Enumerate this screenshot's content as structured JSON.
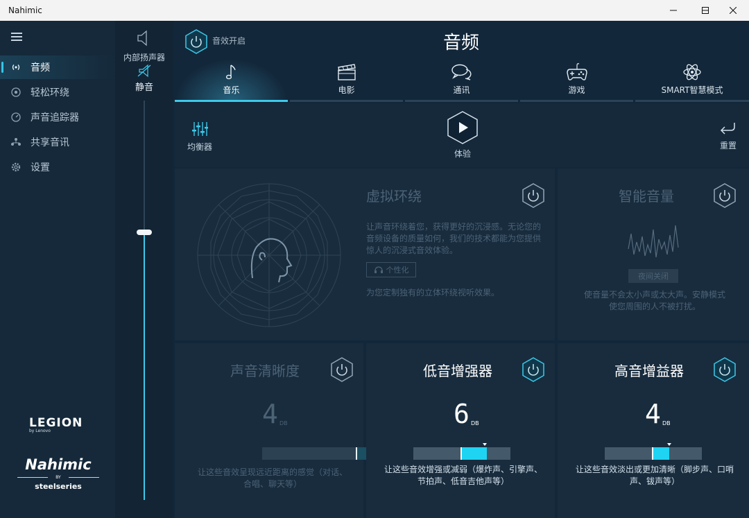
{
  "window": {
    "title": "Nahimic"
  },
  "sidebar": {
    "items": [
      {
        "label": "音频",
        "icon": "audio-waves-icon",
        "active": true
      },
      {
        "label": "轻松环绕",
        "icon": "surround-icon",
        "active": false
      },
      {
        "label": "声音追踪器",
        "icon": "tracker-gauge-icon",
        "active": false
      },
      {
        "label": "共享音讯",
        "icon": "share-network-icon",
        "active": false
      },
      {
        "label": "设置",
        "icon": "gear-icon",
        "active": false
      }
    ],
    "brand_legion": "LEGION",
    "brand_legion_sub": "by Lenovo",
    "brand_nahimic": "Nahimic",
    "brand_by": "BY",
    "brand_steelseries": "steelseries"
  },
  "volume": {
    "device_label": "内部扬声器",
    "mute_label": "静音",
    "level": 0.67
  },
  "header": {
    "effect_on_label": "音效开启",
    "title": "音频"
  },
  "tabs": [
    {
      "label": "音乐",
      "icon": "music-note-icon",
      "active": true
    },
    {
      "label": "电影",
      "icon": "clapperboard-icon",
      "active": false
    },
    {
      "label": "通讯",
      "icon": "chat-bubbles-icon",
      "active": false
    },
    {
      "label": "游戏",
      "icon": "gamepad-icon",
      "active": false
    },
    {
      "label": "SMART智慧模式",
      "icon": "atom-icon",
      "active": false
    }
  ],
  "toolbar": {
    "equalizer_label": "均衡器",
    "try_label": "体验",
    "reset_label": "重置"
  },
  "virtual_surround": {
    "title": "虚拟环绕",
    "enabled": false,
    "description": "让声音环绕着您，获得更好的沉浸感。无论您的音频设备的质量如何，我们的技术都能为您提供惊人的沉浸式音效体验。",
    "personalize_label": "个性化",
    "footer": "为您定制独有的立体环绕视听效果。"
  },
  "smart_volume": {
    "title": "智能音量",
    "enabled": false,
    "mode_label": "夜间关闭",
    "description": "使音量不会太小声或太大声。安静模式使您周围的人不被打扰。"
  },
  "clarity": {
    "title": "声音清晰度",
    "enabled": false,
    "value": "4",
    "unit": "DB",
    "level": 0.2,
    "description": "让这些音效呈现远近距离的感觉（对话、合唱、聊天等）"
  },
  "bass": {
    "title": "低音增强器",
    "enabled": true,
    "value": "6",
    "unit": "DB",
    "level": 0.27,
    "description": "让这些音效增强或减弱（爆炸声、引擎声、节拍声、低音吉他声等）"
  },
  "treble": {
    "title": "高音增益器",
    "enabled": true,
    "value": "4",
    "unit": "DB",
    "level": 0.18,
    "description": "让这些音效淡出或更加清晰（脚步声、口哨声、钹声等）"
  },
  "colors": {
    "accent": "#3ec9e9",
    "disabled_text": "#4c6275",
    "panel_bg": "#182c3e"
  }
}
